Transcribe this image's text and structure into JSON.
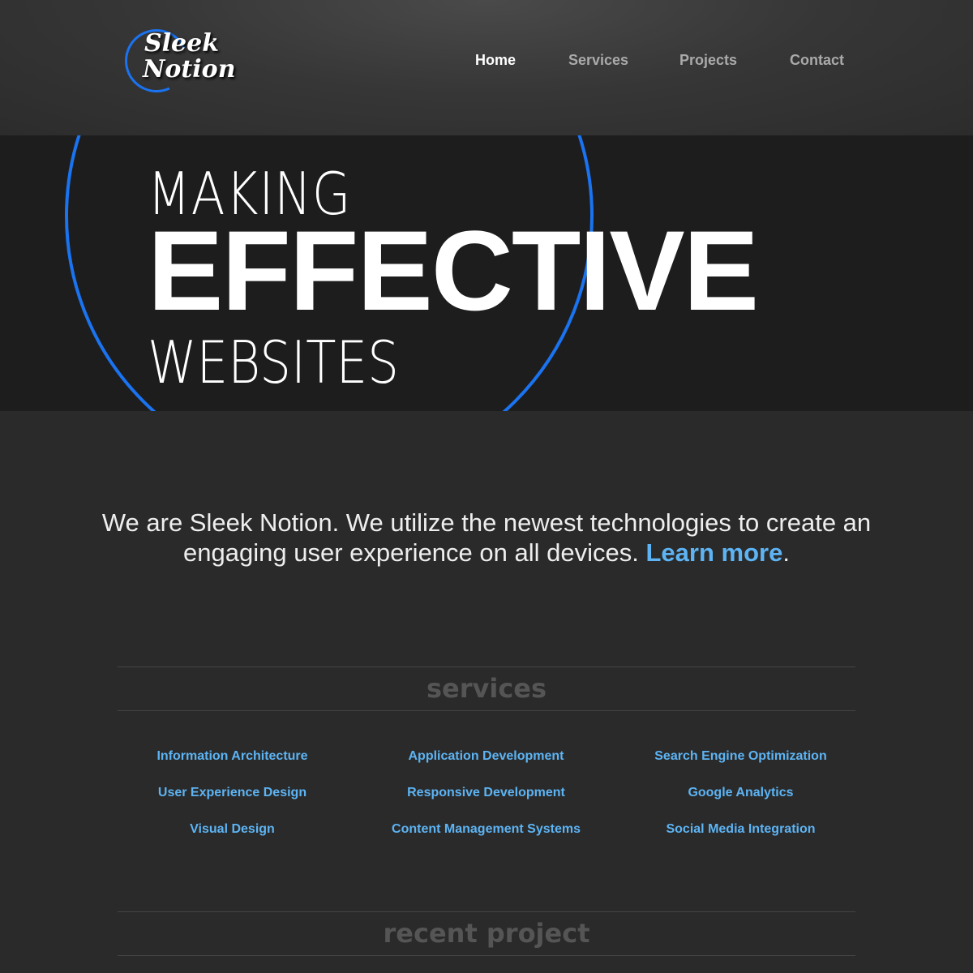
{
  "logo": {
    "line1": "Sleek",
    "line2": "Notion"
  },
  "nav": [
    {
      "label": "Home",
      "active": true
    },
    {
      "label": "Services"
    },
    {
      "label": "Projects"
    },
    {
      "label": "Contact"
    }
  ],
  "hero": {
    "line1": "MAKING",
    "line2": "EFFECTIVE",
    "line3": "WEBSITES"
  },
  "intro": {
    "text": "We are Sleek Notion. We utilize the newest technologies to create an engaging user experience on all devices.",
    "link": "Learn more",
    "end": "."
  },
  "services": {
    "heading": "services",
    "columns": [
      [
        "Information Architecture",
        "User Experience Design",
        "Visual Design"
      ],
      [
        "Application Development",
        "Responsive Development",
        "Content Management Systems"
      ],
      [
        "Search Engine Optimization",
        "Google Analytics",
        "Social Media Integration"
      ]
    ]
  },
  "recent": {
    "heading": "recent project"
  },
  "colors": {
    "accent": "#1a73f0",
    "link": "#5db4f4",
    "background": "#2a2a2a"
  }
}
